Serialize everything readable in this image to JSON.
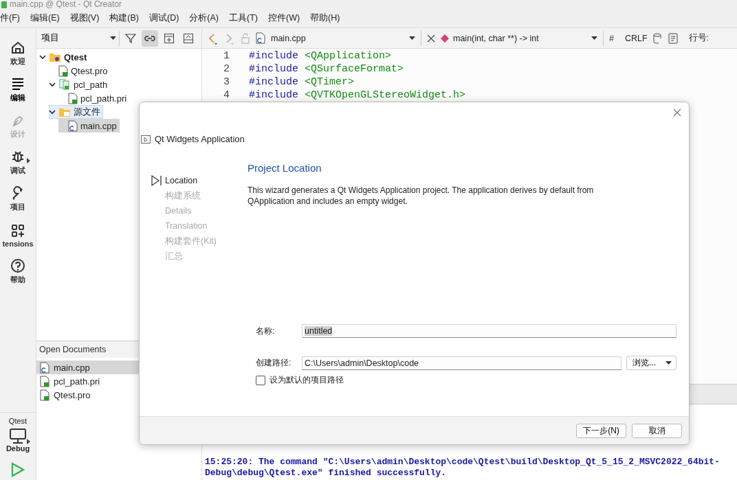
{
  "window": {
    "title": "main.cpp @ Qtest - Qt Creator"
  },
  "menu": [
    "件(F)",
    "编辑(E)",
    "视图(V)",
    "构建(B)",
    "调试(D)",
    "分析(A)",
    "工具(T)",
    "控件(W)",
    "帮助(H)"
  ],
  "mode_bar": {
    "items": [
      {
        "label": "欢迎",
        "selected": false,
        "disabled": false
      },
      {
        "label": "编辑",
        "selected": true,
        "disabled": false
      },
      {
        "label": "设计",
        "selected": false,
        "disabled": true
      },
      {
        "label": "调试",
        "selected": false,
        "disabled": false
      },
      {
        "label": "项目",
        "selected": false,
        "disabled": false
      },
      {
        "label": "tensions",
        "selected": false,
        "disabled": false
      },
      {
        "label": "帮助",
        "selected": false,
        "disabled": false
      }
    ],
    "project": "Qtest",
    "config": "Debug"
  },
  "project_pane": {
    "selector": "项目",
    "tree": [
      {
        "label": "Qtest",
        "kind": "project",
        "expanded": true,
        "selected": false,
        "highlighted": false,
        "children": [
          {
            "label": "Qtest.pro",
            "kind": "pro",
            "selected": false,
            "highlighted": false
          },
          {
            "label": "pcl_path",
            "kind": "pri_folder",
            "expanded": true,
            "selected": false,
            "highlighted": false,
            "children": [
              {
                "label": "pcl_path.pri",
                "kind": "pro",
                "selected": false,
                "highlighted": false
              }
            ]
          },
          {
            "label": "源文件",
            "kind": "source_folder",
            "expanded": true,
            "selected": false,
            "highlighted": true,
            "children": [
              {
                "label": "main.cpp",
                "kind": "cpp",
                "selected": true,
                "highlighted": false
              }
            ]
          }
        ]
      }
    ]
  },
  "open_documents": {
    "title": "Open Documents",
    "items": [
      {
        "name": "main.cpp",
        "kind": "cpp",
        "selected": true
      },
      {
        "name": "pcl_path.pri",
        "kind": "pro",
        "selected": false
      },
      {
        "name": "Qtest.pro",
        "kind": "pro",
        "selected": false
      }
    ]
  },
  "editor": {
    "file": "main.cpp",
    "symbol": "main(int, char **) -> int",
    "hash": "#",
    "line_ending": "CRLF",
    "line_label": "行号:",
    "lines": [
      {
        "number": "1",
        "keyword": "#include",
        "arg": "<QApplication>"
      },
      {
        "number": "2",
        "keyword": "#include",
        "arg": "<QSurfaceFormat>"
      },
      {
        "number": "3",
        "keyword": "#include",
        "arg": "<QTimer>"
      },
      {
        "number": "4",
        "keyword": "#include",
        "arg": "<QVTKOpenGLStereoWidget.h>"
      }
    ]
  },
  "output": {
    "lines": [
      "15:25:20: The command \"C:\\Users\\admin\\Desktop\\code\\Qtest\\build\\Desktop_Qt_5_15_2_MSVC2022_64bit-",
      "Debug\\debug\\Qtest.exe\" finished successfully."
    ]
  },
  "dialog": {
    "title": "Qt Widgets Application",
    "steps": [
      {
        "label": "Location",
        "selected": true
      },
      {
        "label": "构建系统",
        "selected": false
      },
      {
        "label": "Details",
        "selected": false
      },
      {
        "label": "Translation",
        "selected": false
      },
      {
        "label": "构建套件(Kit)",
        "selected": false
      },
      {
        "label": "汇总",
        "selected": false
      }
    ],
    "heading": "Project Location",
    "description": "This wizard generates a Qt Widgets Application project. The application derives by default from QApplication and includes an empty widget.",
    "name_label": "名称:",
    "name_value": "untitled",
    "path_label": "创建路径:",
    "path_value": "C:\\Users\\admin\\Desktop\\code",
    "browse": "浏览...",
    "default_checkbox": {
      "label": "设为默认的项目路径",
      "checked": false
    },
    "buttons": [
      "下一步(N)",
      "取消"
    ]
  }
}
